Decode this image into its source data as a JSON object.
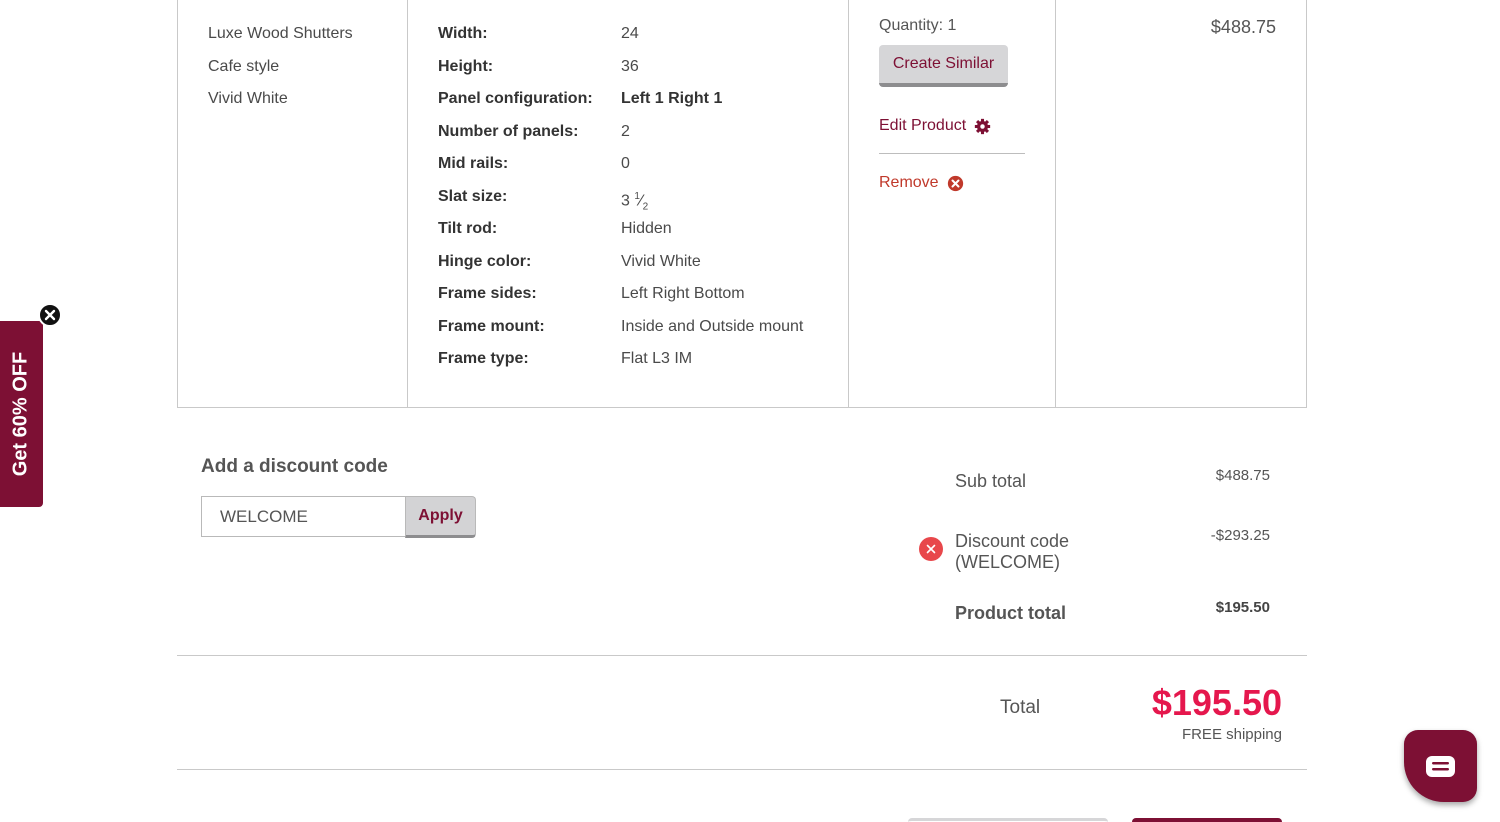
{
  "product": {
    "name_lines": [
      "Luxe Wood Shutters",
      "Cafe style",
      "Vivid White"
    ],
    "specs": [
      {
        "label": "Width:",
        "value": "24"
      },
      {
        "label": "Height:",
        "value": "36"
      },
      {
        "label": "Panel configuration:",
        "value": "Left 1 Right 1"
      },
      {
        "label": "Number of panels:",
        "value": "2"
      },
      {
        "label": "Mid rails:",
        "value": "0"
      },
      {
        "label": "Slat size:",
        "value": "3",
        "fraction_num": "1",
        "fraction_den": "2"
      },
      {
        "label": "Tilt rod:",
        "value": "Hidden"
      },
      {
        "label": "Hinge color:",
        "value": "Vivid White"
      },
      {
        "label": "Frame sides:",
        "value": "Left Right Bottom"
      },
      {
        "label": "Frame mount:",
        "value": "Inside and Outside mount"
      },
      {
        "label": "Frame type:",
        "value": "Flat L3 IM"
      }
    ],
    "quantity_label": "Quantity:",
    "quantity": "1",
    "create_similar": "Create Similar",
    "edit_product": "Edit Product",
    "remove": "Remove",
    "price": "$488.75"
  },
  "discount": {
    "title": "Add a discount code",
    "input_value": "WELCOME",
    "apply": "Apply"
  },
  "summary": {
    "subtotal_label": "Sub total",
    "subtotal": "$488.75",
    "discount_label_1": "Discount code",
    "discount_label_2": "(WELCOME)",
    "discount": "-$293.25",
    "product_total_label": "Product total",
    "product_total": "$195.50",
    "total_label": "Total",
    "total": "$195.50",
    "shipping": "FREE shipping"
  },
  "promo": {
    "text": "Get 60% OFF"
  },
  "colors": {
    "brand": "#7d1034",
    "accent": "#e5174d",
    "remove": "#e8474b"
  }
}
